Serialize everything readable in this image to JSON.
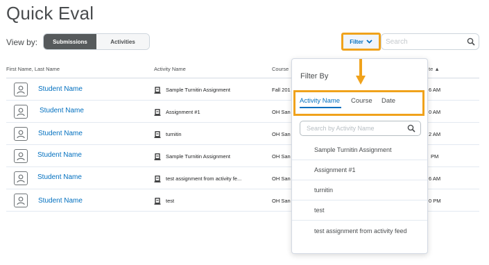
{
  "page": {
    "title": "Quick Eval"
  },
  "view_by": {
    "label": "View by:",
    "options": [
      "Submissions",
      "Activities"
    ],
    "selected": "Submissions"
  },
  "toolbar": {
    "filter_label": "Filter",
    "search_placeholder": "Search"
  },
  "table": {
    "columns": [
      "First Name, Last Name",
      "Activity Name",
      "Course",
      "te"
    ],
    "rows": [
      {
        "name": "Student Name",
        "activity": "Sample Turnitin Assignment",
        "course": "Fall 201",
        "date": "6 AM"
      },
      {
        "name": "Student Name",
        "activity": "Assignment #1",
        "course": "OH San",
        "date": "0 AM"
      },
      {
        "name": "Student Name",
        "activity": "turnitin",
        "course": "OH San",
        "date": "2 AM"
      },
      {
        "name": "Student Name",
        "activity": "Sample Turnitin Assignment",
        "course": "OH San",
        "date": "PM"
      },
      {
        "name": "Student Name",
        "activity": "test assignment from activity fe...",
        "course": "OH San",
        "date": "6 AM"
      },
      {
        "name": "Student Name",
        "activity": "test",
        "course": "OH San",
        "date": "0 PM"
      }
    ]
  },
  "filter_popover": {
    "title": "Filter By",
    "tabs": [
      "Activity Name",
      "Course",
      "Date"
    ],
    "active_tab": "Activity Name",
    "search_placeholder": "Search by Activity Name",
    "items": [
      "Sample Turnitin Assignment",
      "Assignment #1",
      "turnitin",
      "test",
      "test assignment from activity feed"
    ]
  },
  "colors": {
    "accent": "#006fbf",
    "highlight": "#f0a21b",
    "active_toggle": "#565a5c"
  },
  "icons": {
    "filter_chevron": "chevron-down-icon",
    "search": "search-icon",
    "avatar": "user-icon",
    "activity": "assignment-icon",
    "sort": "sort-ascending-icon",
    "annotation": "arrow-down-icon"
  }
}
